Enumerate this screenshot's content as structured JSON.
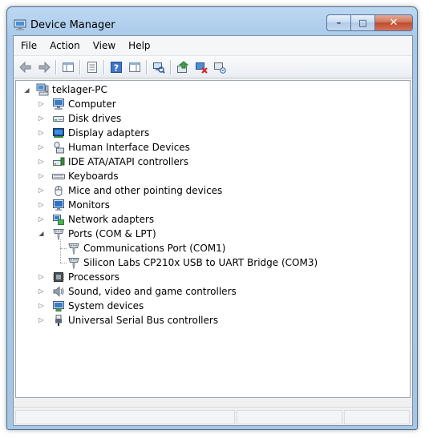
{
  "window": {
    "title": "Device Manager",
    "caption_buttons": {
      "minimize": "–",
      "maximize": "□",
      "close": "✕"
    }
  },
  "menu": [
    {
      "label": "File"
    },
    {
      "label": "Action"
    },
    {
      "label": "View"
    },
    {
      "label": "Help"
    }
  ],
  "toolbar": [
    {
      "icon": "back-arrow-icon"
    },
    {
      "icon": "forward-arrow-icon"
    },
    {
      "icon": "show-hide-console-tree-icon"
    },
    {
      "icon": "properties-icon"
    },
    {
      "icon": "help-icon"
    },
    {
      "icon": "action-pane-icon"
    },
    {
      "icon": "scan-hardware-changes-icon"
    },
    {
      "icon": "update-driver-icon"
    },
    {
      "icon": "disable-device-icon"
    },
    {
      "icon": "uninstall-device-icon"
    }
  ],
  "tree": {
    "root": {
      "label": "teklager-PC",
      "icon": "computer-root-icon",
      "expanded": true
    },
    "categories": [
      {
        "label": "Computer",
        "icon": "computer-icon",
        "expanded": false
      },
      {
        "label": "Disk drives",
        "icon": "disk-drive-icon",
        "expanded": false
      },
      {
        "label": "Display adapters",
        "icon": "display-adapter-icon",
        "expanded": false
      },
      {
        "label": "Human Interface Devices",
        "icon": "hid-icon",
        "expanded": false
      },
      {
        "label": "IDE ATA/ATAPI controllers",
        "icon": "ide-controller-icon",
        "expanded": false
      },
      {
        "label": "Keyboards",
        "icon": "keyboard-icon",
        "expanded": false
      },
      {
        "label": "Mice and other pointing devices",
        "icon": "mouse-icon",
        "expanded": false
      },
      {
        "label": "Monitors",
        "icon": "monitor-icon",
        "expanded": false
      },
      {
        "label": "Network adapters",
        "icon": "network-adapter-icon",
        "expanded": false
      },
      {
        "label": "Ports (COM & LPT)",
        "icon": "port-icon",
        "expanded": true,
        "children": [
          {
            "label": "Communications Port (COM1)",
            "icon": "port-icon"
          },
          {
            "label": "Silicon Labs CP210x USB to UART Bridge (COM3)",
            "icon": "port-icon"
          }
        ]
      },
      {
        "label": "Processors",
        "icon": "processor-icon",
        "expanded": false
      },
      {
        "label": "Sound, video and game controllers",
        "icon": "sound-icon",
        "expanded": false
      },
      {
        "label": "System devices",
        "icon": "system-devices-icon",
        "expanded": false
      },
      {
        "label": "Universal Serial Bus controllers",
        "icon": "usb-icon",
        "expanded": false
      }
    ]
  },
  "statusbar": {
    "panes": [
      "",
      "",
      ""
    ]
  }
}
